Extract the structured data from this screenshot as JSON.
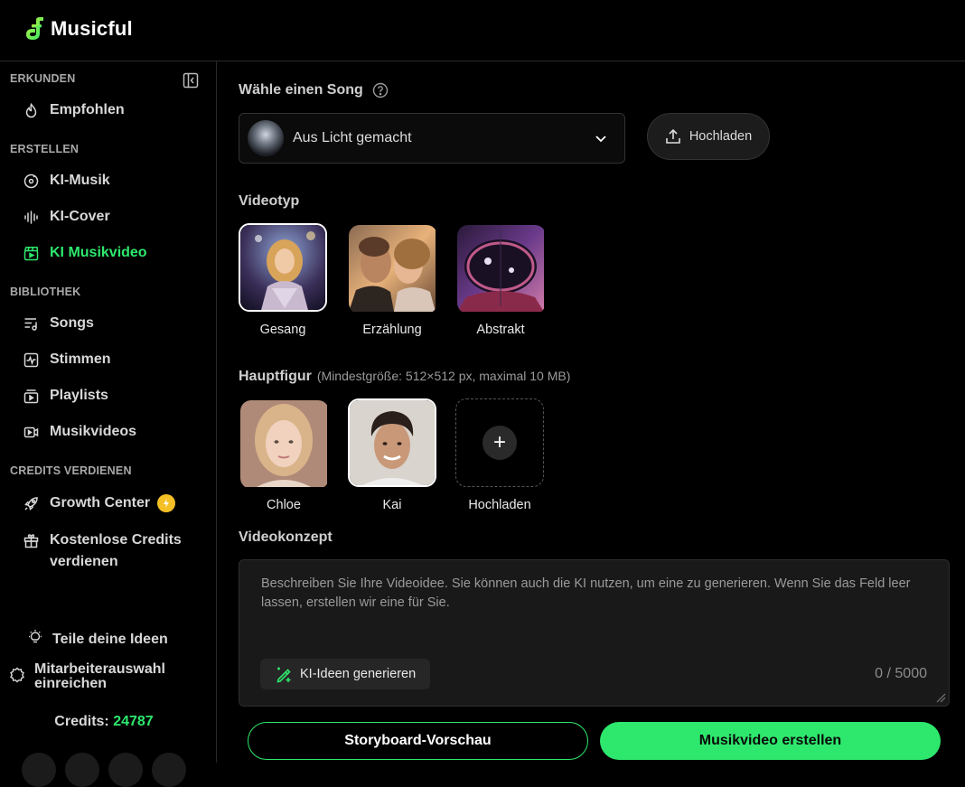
{
  "app": {
    "name": "Musicful",
    "brand_color": "#2ee86d"
  },
  "sidebar": {
    "sections": {
      "explore": "ERKUNDEN",
      "create": "ERSTELLEN",
      "library": "BIBLIOTHEK",
      "earn": "CREDITS VERDIENEN"
    },
    "items": {
      "recommended": "Empfohlen",
      "ai_music": "KI-Musik",
      "ai_cover": "KI-Cover",
      "ai_music_video": "KI Musikvideo",
      "songs": "Songs",
      "voices": "Stimmen",
      "playlists": "Playlists",
      "music_videos": "Musikvideos",
      "growth_center": "Growth Center",
      "free_credits_line1": "Kostenlose Credits",
      "free_credits_line2": "verdienen"
    },
    "share_ideas": "Teile deine Ideen",
    "employee_line1": "Mitarbeiterauswahl",
    "employee_line2": "einreichen",
    "credits_label": "Credits:",
    "credits_value": "24787",
    "active_item": "KI Musikvideo"
  },
  "main": {
    "choose_song_label": "Wähle einen Song",
    "selected_song": "Aus Licht gemacht",
    "upload_button": "Hochladen",
    "video_type_label": "Videotyp",
    "video_types": [
      {
        "label": "Gesang",
        "selected": true
      },
      {
        "label": "Erzählung",
        "selected": false
      },
      {
        "label": "Abstrakt",
        "selected": false
      }
    ],
    "main_character_label": "Hauptfigur",
    "main_character_hint": "(Mindestgröße: 512×512 px, maximal 10 MB)",
    "characters": [
      {
        "label": "Chloe",
        "selected": false
      },
      {
        "label": "Kai",
        "selected": true
      }
    ],
    "character_upload_label": "Hochladen",
    "concept_label": "Videokonzept",
    "concept_placeholder": "Beschreiben Sie Ihre Videoidee. Sie können auch die KI nutzen, um eine zu generieren. Wenn Sie das Feld leer lassen, erstellen wir eine für Sie.",
    "generate_ideas_button": "KI-Ideen generieren",
    "char_counter": "0 / 5000",
    "storyboard_button": "Storyboard-Vorschau",
    "create_button": "Musikvideo erstellen"
  }
}
